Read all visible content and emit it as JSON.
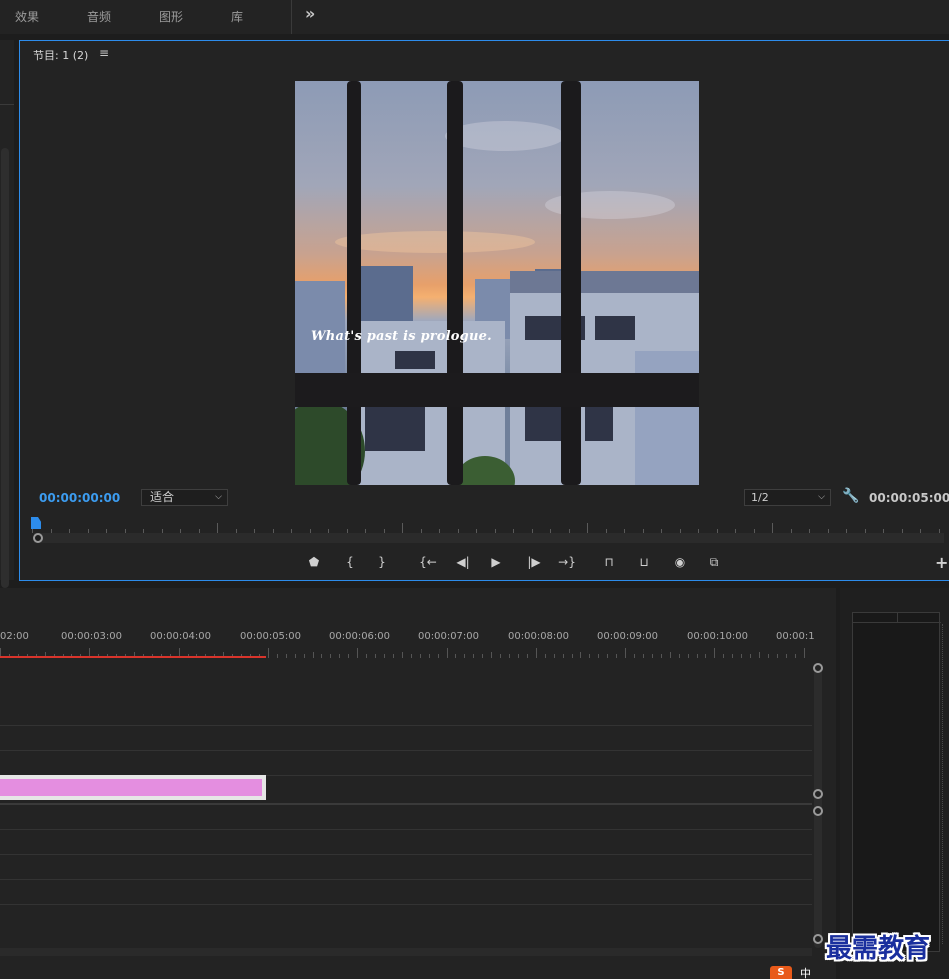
{
  "workspace_tabs": [
    "效果",
    "音频",
    "图形",
    "库"
  ],
  "overflow_label": "»",
  "monitor": {
    "title": "节目: 1 (2)",
    "menu_glyph": "≡",
    "caption": "What's past is prologue.",
    "timecode_current": "00:00:00:00",
    "timecode_duration": "00:00:05:00",
    "fit_value": "适合",
    "resolution_value": "1/2",
    "add_button": "+"
  },
  "transport": {
    "marker": "⬟",
    "mark_in": "{",
    "mark_out": "}",
    "go_in": "{←",
    "step_back": "◀|",
    "play": "▶",
    "step_forward": "|▶",
    "go_out": "→}",
    "lift": "⊓",
    "extract": "⊔",
    "export_frame": "◉",
    "compare": "⧉"
  },
  "timeline": {
    "labels": [
      "02:00",
      "00:00:03:00",
      "00:00:04:00",
      "00:00:05:00",
      "00:00:06:00",
      "00:00:07:00",
      "00:00:08:00",
      "00:00:09:00",
      "00:00:10:00",
      "00:00:1"
    ]
  },
  "watermark": "最需教育",
  "tray": {
    "logo": "S",
    "ime": "中"
  },
  "colors": {
    "accent": "#2d8ceb",
    "clip": "#e48ee0",
    "work_area": "#d9342b"
  }
}
